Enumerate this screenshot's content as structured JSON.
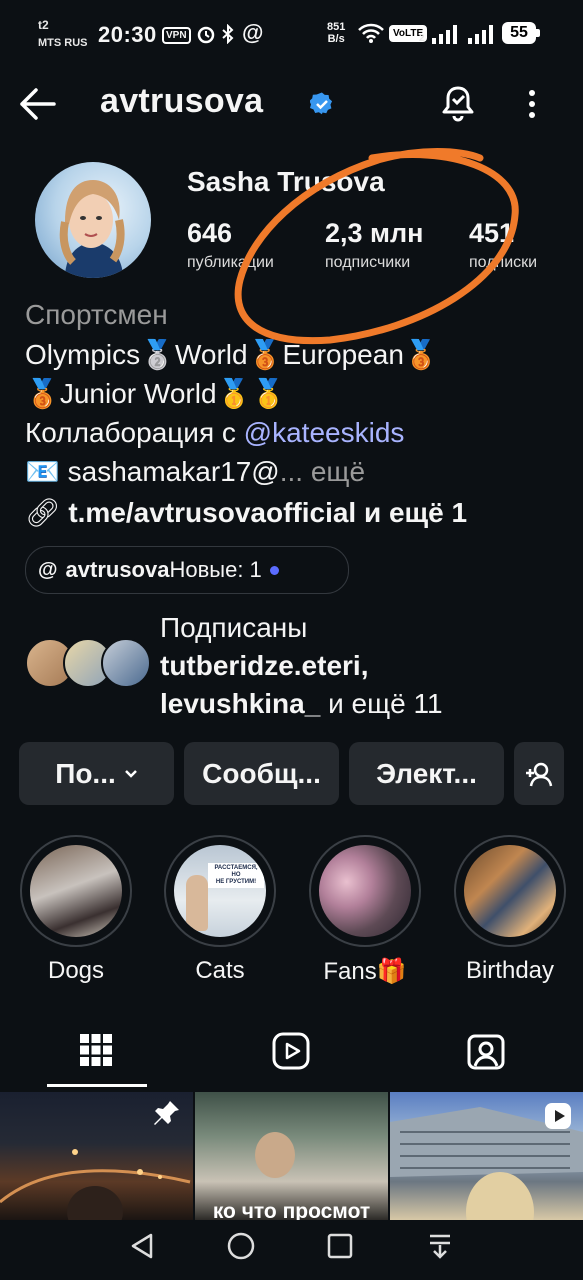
{
  "status_bar": {
    "carrier_line1": "t2",
    "carrier_line2": "MTS RUS",
    "time": "20:30",
    "vpn_label": "VPN",
    "speed_value": "851",
    "speed_unit": "B/s",
    "volte_label": "VoLTE",
    "sim_index": "2",
    "battery": "55"
  },
  "header": {
    "username": "avtrusova",
    "verified_icon": "verified-badge-icon",
    "notifications_icon": "bell-check-icon",
    "more_icon": "more-vertical-icon"
  },
  "profile": {
    "display_name": "Sasha Trusova",
    "stats": [
      {
        "value": "646",
        "label": "публикации"
      },
      {
        "value": "2,3 млн",
        "label": "подписчики"
      },
      {
        "value": "451",
        "label": "подписки"
      }
    ],
    "category": "Спортсмен",
    "bio_line1": "Olympics🥈World🥉European🥉",
    "bio_line2": "🥉Junior World🥇🥇",
    "bio_line3_prefix": "Коллаборация с ",
    "bio_line3_mention": "kateeskids",
    "bio_line4": "📧 sashamakar17",
    "bio_line4_more": "... ещё",
    "link_text": "t.me/avtrusovaofficial",
    "link_more": " и ещё 1",
    "threads_badge_user": "avtrusova",
    "threads_badge_new": " Новые: 1",
    "followed_by_title": "Подписаны",
    "followed_by_user1": "tutberidze.eteri,",
    "followed_by_user2": "levushkina_",
    "followed_by_more": " и ещё 11"
  },
  "actions": {
    "follow_label": "По...",
    "message_label": "Сообщ...",
    "email_label": "Элект...",
    "suggest_icon": "add-person-icon"
  },
  "highlights": [
    {
      "label": "Dogs"
    },
    {
      "label": "Cats",
      "story_text1": "РАССТАЕМСЯ,",
      "story_text2": "НО",
      "story_text3": "НЕ ГРУСТИМ!"
    },
    {
      "label": "Fans🎁"
    },
    {
      "label": "Birthday"
    }
  ],
  "tabs": [
    "grid-icon",
    "reels-icon",
    "tagged-icon"
  ],
  "grid": {
    "caption_text": "ко что просмот"
  },
  "nav": [
    "back-triangle-icon",
    "home-circle-icon",
    "recents-square-icon",
    "menu-down-icon"
  ],
  "colors": {
    "background": "#0c1014",
    "button": "#25292e",
    "accent_link": "#a9b4ff",
    "verified": "#3897f0",
    "annotation_orange": "#f07a2a"
  }
}
